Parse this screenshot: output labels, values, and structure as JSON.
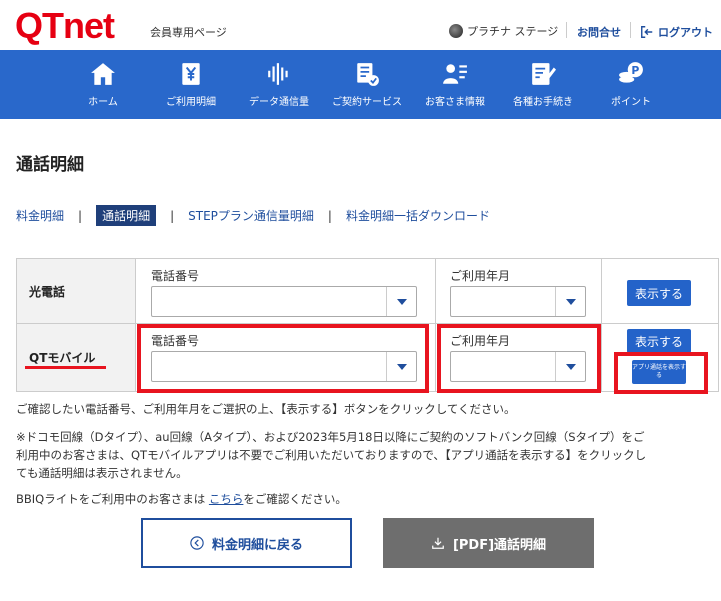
{
  "header": {
    "logo": "QTnet",
    "member_page": "会員専用ページ",
    "stage": "プラチナ ステージ",
    "contact": "お問合せ",
    "logout": "ログアウト"
  },
  "nav": [
    {
      "label": "ホーム",
      "icon": "home-icon"
    },
    {
      "label": "ご利用明細",
      "icon": "yen-document-icon"
    },
    {
      "label": "データ通信量",
      "icon": "waveform-icon"
    },
    {
      "label": "ご契約サービス",
      "icon": "contract-icon"
    },
    {
      "label": "お客さま情報",
      "icon": "user-info-icon"
    },
    {
      "label": "各種お手続き",
      "icon": "form-edit-icon"
    },
    {
      "label": "ポイント",
      "icon": "points-coin-icon"
    }
  ],
  "page_title": "通話明細",
  "tabs": [
    "料金明細",
    "通話明細",
    "STEPプラン通信量明細",
    "料金明細一括ダウンロード"
  ],
  "tab_separator": "|",
  "table": {
    "rows": [
      {
        "label": "光電話",
        "phone_label": "電話番号",
        "month_label": "ご利用年月",
        "show_button": "表示する"
      },
      {
        "label": "QTモバイル",
        "phone_label": "電話番号",
        "month_label": "ご利用年月",
        "show_button": "表示する",
        "app_button": "アプリ通話を表示する"
      }
    ]
  },
  "notes": {
    "line1": "ご確認したい電話番号、ご利用年月をご選択の上、【表示する】ボタンをクリックしてください。",
    "line2a": "※ドコモ回線（Dタイプ）、au回線（Aタイプ）、および2023年5月18日以降にご契約のソフトバンク回線（Sタイプ）をご",
    "line2b": "利用中のお客さまは、QTモバイルアプリは不要でご利用いただいておりますので、【アプリ通話を表示する】をクリックし",
    "line2c": "ても通話明細は表示されません。",
    "bbiq_prefix": "BBIQライトをご利用中のお客さまは",
    "bbiq_link": "こちら",
    "bbiq_suffix": "をご確認ください。"
  },
  "buttons": {
    "back": "料金明細に戻る",
    "pdf": "[PDF]通話明細"
  },
  "colors": {
    "brand_red": "#e60012",
    "nav_blue": "#2968cb",
    "button_blue": "#2463c9",
    "highlight_red": "#e8141f"
  }
}
